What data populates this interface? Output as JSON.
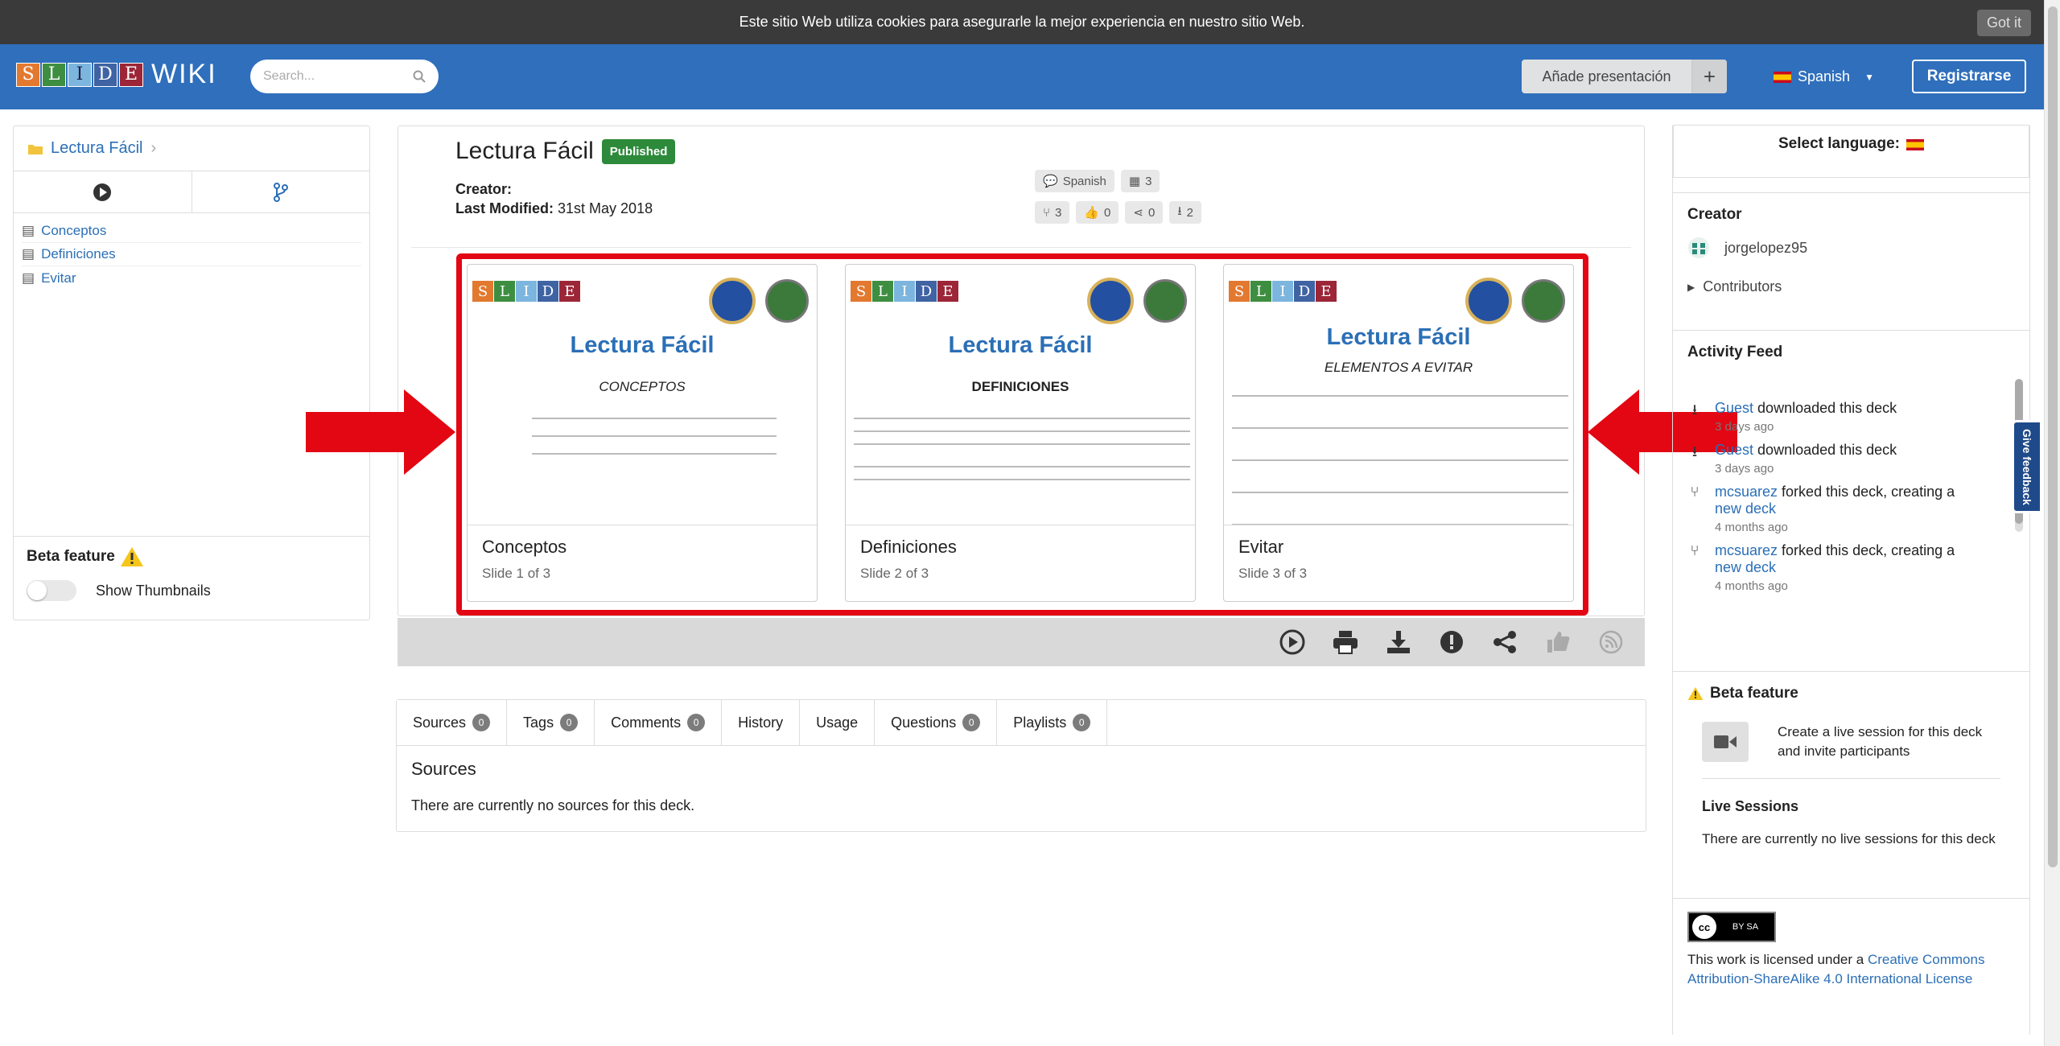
{
  "cookie_banner": {
    "text": "Este sitio Web utiliza cookies para asegurarle la mejor experiencia en nuestro sitio Web.",
    "button": "Got it"
  },
  "header": {
    "logo_letters": [
      "S",
      "L",
      "I",
      "D",
      "E"
    ],
    "logo_wiki": "WIKI",
    "search_placeholder": "Search...",
    "add_presentation": "Añade presentación",
    "add_plus": "+",
    "language": "Spanish",
    "register": "Registrarse"
  },
  "left_panel": {
    "breadcrumb": "Lectura Fácil",
    "tree": [
      "Conceptos",
      "Definiciones",
      "Evitar"
    ],
    "beta_title": "Beta feature",
    "show_thumbnails": "Show Thumbnails"
  },
  "deck": {
    "title": "Lectura Fácil",
    "status": "Published",
    "creator_label": "Creator:",
    "last_modified_label": "Last Modified:",
    "last_modified_value": "31st May 2018",
    "language": "Spanish",
    "slides_count": "3",
    "forks": "3",
    "likes": "0",
    "shares": "0",
    "downloads": "2"
  },
  "slides": [
    {
      "heading": "Lectura Fácil",
      "subtitle": "CONCEPTOS",
      "title": "Conceptos",
      "position": "Slide 1 of 3"
    },
    {
      "heading": "Lectura Fácil",
      "subtitle": "DEFINICIONES",
      "title": "Definiciones",
      "position": "Slide 2 of 3"
    },
    {
      "heading": "Lectura Fácil",
      "subtitle": "ELEMENTOS A EVITAR",
      "title": "Evitar",
      "position": "Slide 3 of 3"
    }
  ],
  "tabs": [
    {
      "label": "Sources",
      "count": "0"
    },
    {
      "label": "Tags",
      "count": "0"
    },
    {
      "label": "Comments",
      "count": "0"
    },
    {
      "label": "History",
      "count": ""
    },
    {
      "label": "Usage",
      "count": ""
    },
    {
      "label": "Questions",
      "count": "0"
    },
    {
      "label": "Playlists",
      "count": "0"
    }
  ],
  "sources": {
    "heading": "Sources",
    "empty_text": "There are currently no sources for this deck."
  },
  "right_panel": {
    "select_language": "Select language:",
    "creator_heading": "Creator",
    "creator_name": "jorgelopez95",
    "contributors": "Contributors",
    "activity_heading": "Activity Feed",
    "activities": [
      {
        "user": "Guest",
        "text": "downloaded this deck",
        "link": "",
        "ago": "3 days ago"
      },
      {
        "user": "Guest",
        "text": "downloaded this deck",
        "link": "",
        "ago": "3 days ago"
      },
      {
        "user": "mcsuarez",
        "text": "forked this deck, creating a",
        "link": "new deck",
        "ago": "4 months ago"
      },
      {
        "user": "mcsuarez",
        "text": "forked this deck, creating a",
        "link": "new deck",
        "ago": "4 months ago"
      }
    ],
    "beta_heading": "Beta feature",
    "live_text": "Create a live session for this deck and invite participants",
    "live_sessions_heading": "Live Sessions",
    "live_sessions_empty": "There are currently no live sessions for this deck",
    "license_prefix": "This work is licensed under a",
    "license_link": "Creative Commons Attribution-ShareAlike 4.0 International License",
    "cc_badge": "BY SA"
  },
  "feedback_tab": "Give feedback",
  "colors": {
    "topbar": "#2f6fbc",
    "annotation": "#e30613",
    "link": "#2b6fb6",
    "published": "#2c8a3a"
  }
}
